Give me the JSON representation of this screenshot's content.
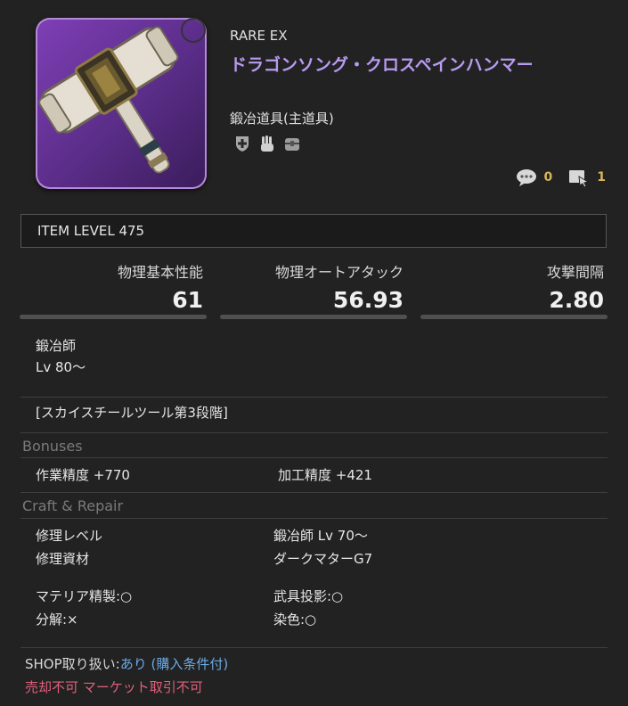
{
  "item": {
    "rarity": "RARE EX",
    "name": "ドラゴンソング・クロスペインハンマー",
    "category": "鍛冶道具(主道具)",
    "class_icons": [
      "shield-cross-icon",
      "hand-icon",
      "chest-icon"
    ],
    "comments_count": "0",
    "edits_count": "1",
    "item_level": "ITEM LEVEL 475"
  },
  "stats": {
    "physical_damage": {
      "label": "物理基本性能",
      "value": "61"
    },
    "auto_attack": {
      "label": "物理オートアタック",
      "value": "56.93"
    },
    "delay": {
      "label": "攻撃間隔",
      "value": "2.80"
    }
  },
  "job": {
    "name": "鍛冶師",
    "level": "Lv 80〜"
  },
  "series": "[スカイスチールツール第3段階]",
  "bonuses": {
    "title": "Bonuses",
    "left": "作業精度 +770",
    "right": "加工精度 +421"
  },
  "craft_repair": {
    "title": "Craft & Repair",
    "repair_level_label": "修理レベル",
    "repair_level_value": "鍛冶師 Lv 70〜",
    "repair_material_label": "修理資材",
    "repair_material_value": "ダークマターG7",
    "materia": "マテリア精製:○",
    "glamour": "武具投影:○",
    "desynth": "分解:×",
    "dye": "染色:○"
  },
  "shop": {
    "prefix": "SHOP取り扱い:",
    "available": "あり",
    "condition": "(購入条件付)"
  },
  "trade": "売却不可 マーケット取引不可",
  "colors": {
    "background": "#222222",
    "name": "#b89af0",
    "counter": "#d8b55a",
    "link": "#6aa9e6",
    "restriction": "#e0607a"
  }
}
